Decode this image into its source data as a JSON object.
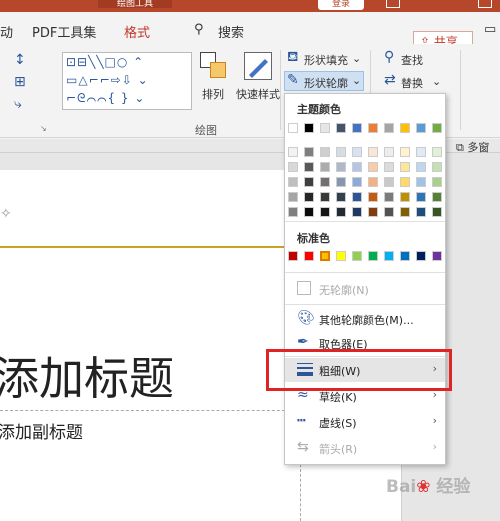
{
  "titlebar": {
    "context_label": "绘图工具",
    "login_label": "登录",
    "accent": "#b7472a"
  },
  "tabs": [
    {
      "label": "动"
    },
    {
      "label": "PDF工具集"
    },
    {
      "label": "格式",
      "active": true
    },
    {
      "label": "搜索"
    }
  ],
  "share_label": "共享",
  "ribbon": {
    "arrange_label": "排列",
    "quick_style_label": "快速样式",
    "fill_label": "形状填充",
    "outline_label": "形状轮廓",
    "find_label": "查找",
    "replace_label": "替换",
    "group_label": "绘图",
    "shape_rows": [
      "⊡⊟╲╲□○ ⌃",
      "▭△⌐⌐⇨⇩ ⌄",
      "⌐ᘓ⌒⌒{ } ⌄"
    ]
  },
  "subbar": {
    "multi_window_label": "多窗"
  },
  "slide": {
    "title_text": "添加标题",
    "subtitle_text": "添加副标题"
  },
  "menu": {
    "theme_heading": "主题颜色",
    "standard_heading": "标准色",
    "theme_top_row": [
      "#ffffff",
      "#000000",
      "#e7e6e6",
      "#44546a",
      "#4472c4",
      "#ed7d31",
      "#a5a5a5",
      "#ffc000",
      "#5b9bd5",
      "#70ad47"
    ],
    "theme_shades": [
      [
        "#f2f2f2",
        "#7f7f7f",
        "#d0cece",
        "#d6dce4",
        "#d9e2f3",
        "#fbe5d5",
        "#ededed",
        "#fff2cc",
        "#deebf6",
        "#e2efd9"
      ],
      [
        "#d8d8d8",
        "#595959",
        "#aeabab",
        "#adb9ca",
        "#b4c6e7",
        "#f7cbac",
        "#dbdbdb",
        "#fee599",
        "#bdd7ee",
        "#c5e0b3"
      ],
      [
        "#bfbfbf",
        "#3f3f3f",
        "#757070",
        "#8496b0",
        "#8eaadb",
        "#f4b183",
        "#c9c9c9",
        "#ffd965",
        "#9dc3e6",
        "#a8d08d"
      ],
      [
        "#a5a5a5",
        "#262626",
        "#3a3838",
        "#323f4f",
        "#2f5496",
        "#c55a11",
        "#7b7b7b",
        "#bf9000",
        "#2e75b5",
        "#538135"
      ],
      [
        "#7f7f7f",
        "#0c0c0c",
        "#171616",
        "#222a35",
        "#1f3864",
        "#833c0b",
        "#525252",
        "#7f6000",
        "#1e4e79",
        "#375623"
      ]
    ],
    "standard_colors": [
      "#c00000",
      "#ff0000",
      "#ffc000",
      "#ffff00",
      "#92d050",
      "#00b050",
      "#00b0f0",
      "#0070c0",
      "#002060",
      "#7030a0"
    ],
    "items": {
      "no_outline": "无轮廓(N)",
      "more_colors": "其他轮廓颜色(M)...",
      "eyedropper": "取色器(E)",
      "weight": "粗细(W)",
      "sketched": "草绘(K)",
      "dashes": "虚线(S)",
      "arrows": "箭头(R)"
    }
  },
  "watermark": "Bai du 经验"
}
